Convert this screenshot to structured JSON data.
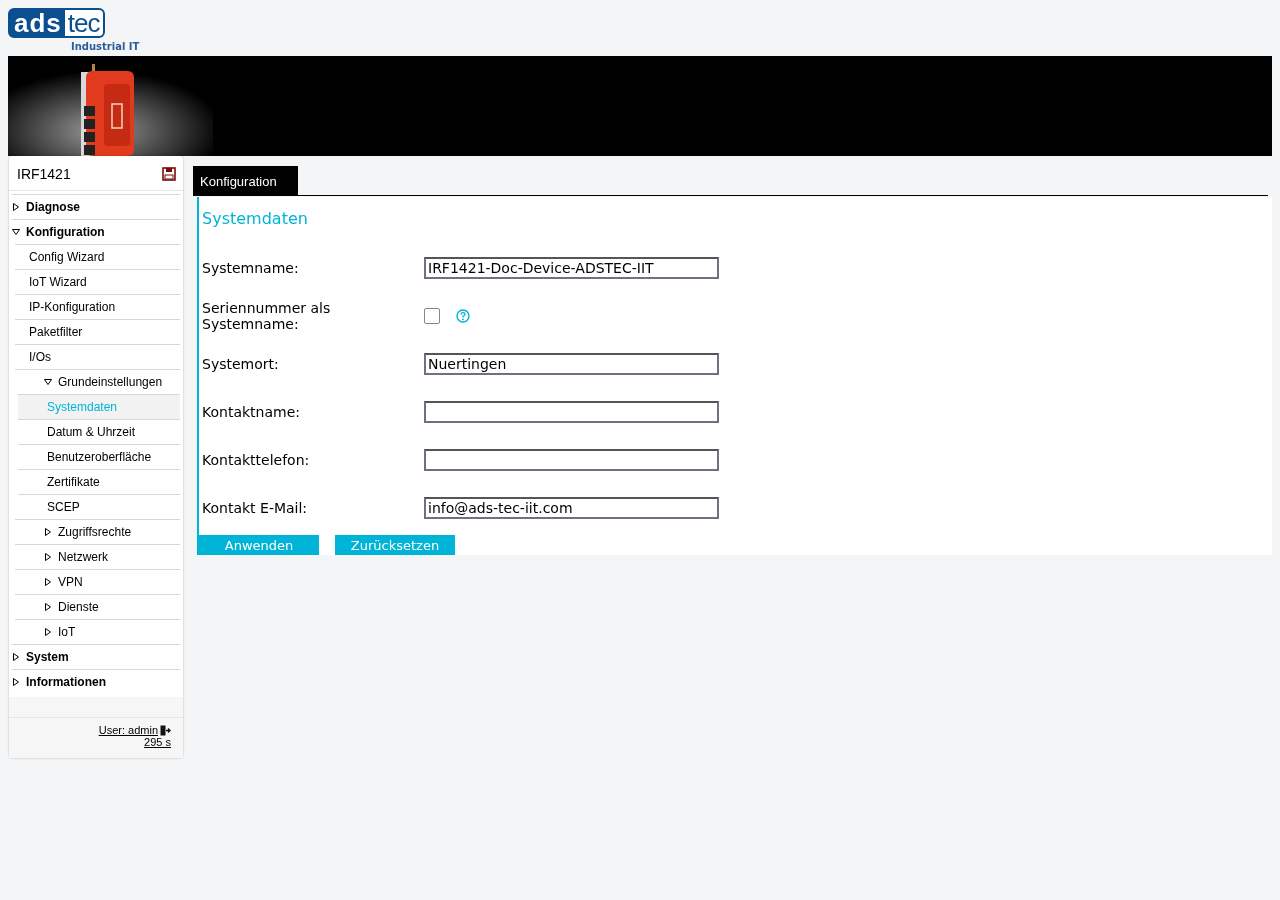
{
  "logo": {
    "part1": "ads",
    "part2": "tec",
    "tagline": "Industrial IT"
  },
  "sidebar": {
    "device": "IRF1421",
    "items": [
      {
        "label": "Diagnose",
        "kind": "folder",
        "expanded": false
      },
      {
        "label": "Konfiguration",
        "kind": "folder",
        "expanded": true,
        "children": [
          {
            "label": "Config Wizard",
            "kind": "leaf",
            "selected": false
          },
          {
            "label": "IoT Wizard",
            "kind": "leaf",
            "selected": false
          },
          {
            "label": "IP-Konfiguration",
            "kind": "leaf",
            "selected": false
          },
          {
            "label": "Paketfilter",
            "kind": "leaf",
            "selected": false
          },
          {
            "label": "I/Os",
            "kind": "leaf",
            "selected": false
          },
          {
            "label": "Grundeinstellungen",
            "kind": "folder",
            "expanded": true,
            "children": [
              {
                "label": "Systemdaten",
                "kind": "leaf",
                "selected": true
              },
              {
                "label": "Datum & Uhrzeit",
                "kind": "leaf",
                "selected": false
              },
              {
                "label": "Benutzeroberfläche",
                "kind": "leaf",
                "selected": false
              },
              {
                "label": "Zertifikate",
                "kind": "leaf",
                "selected": false
              },
              {
                "label": "SCEP",
                "kind": "leaf",
                "selected": false
              }
            ]
          },
          {
            "label": "Zugriffsrechte",
            "kind": "folder",
            "expanded": false
          },
          {
            "label": "Netzwerk",
            "kind": "folder",
            "expanded": false
          },
          {
            "label": "VPN",
            "kind": "folder",
            "expanded": false
          },
          {
            "label": "Dienste",
            "kind": "folder",
            "expanded": false
          },
          {
            "label": "IoT",
            "kind": "folder",
            "expanded": false
          }
        ]
      },
      {
        "label": "System",
        "kind": "folder",
        "expanded": false
      },
      {
        "label": "Informationen",
        "kind": "folder",
        "expanded": false
      }
    ],
    "user": "User: admin",
    "timer": "295 s"
  },
  "tabs": [
    {
      "label": "Konfiguration",
      "selected": true
    }
  ],
  "section_title": "Systemdaten",
  "fields": [
    {
      "label": "Systemname:",
      "kind": "text",
      "value": "IRF1421-Doc-Device-ADSTEC-IIT"
    },
    {
      "label": "Seriennummer als Systemname:",
      "kind": "checkbox",
      "checked": false
    },
    {
      "label": "Systemort:",
      "kind": "text",
      "value": "Nuertingen"
    },
    {
      "label": "Kontaktname:",
      "kind": "text"
    },
    {
      "label": "Kontakttelefon:",
      "kind": "text"
    },
    {
      "label": "Kontakt E-Mail:",
      "kind": "text",
      "value": "info@ads-tec-iit.com"
    }
  ],
  "buttons": [
    "Anwenden",
    "Zurücksetzen"
  ]
}
